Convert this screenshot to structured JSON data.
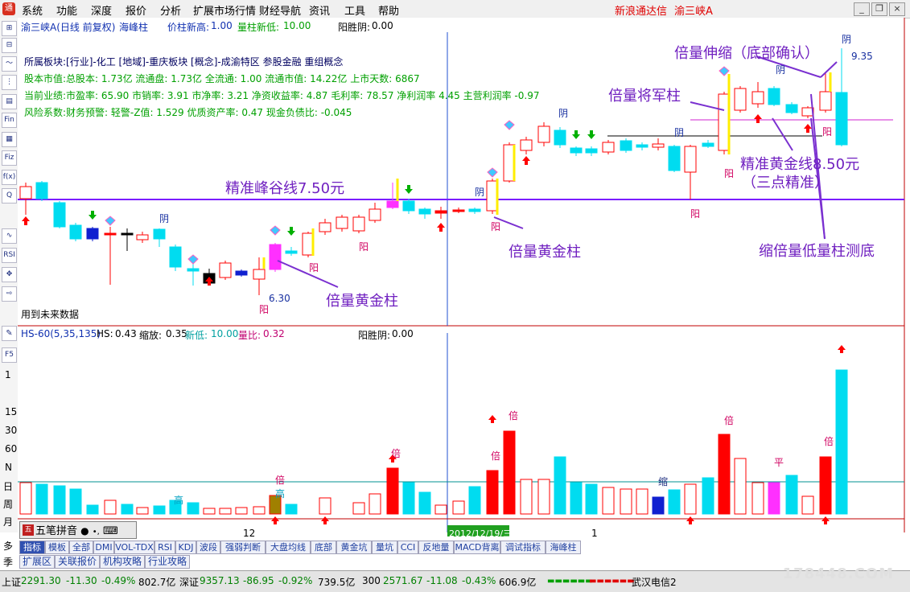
{
  "menubar": {
    "items": [
      "系统",
      "功能",
      "深度",
      "报价",
      "分析",
      "扩展市场行情",
      "财经导航",
      "资讯",
      "工具",
      "帮助"
    ],
    "app_name": "新浪通达信",
    "stock_name": "渝三峡A"
  },
  "price_panel": {
    "stock_label": "渝三峡A(日线 前复权)",
    "indicator_name": "海峰柱",
    "price_new_high_label": "价柱新高:",
    "price_new_high_value": "1.00",
    "vol_new_low_label": "量柱新低:",
    "vol_new_low_value": "10.00",
    "ysy_label": "阳胜阴:",
    "ysy_value": "0.00",
    "info_lines": [
      "所属板块:[行业]-化工 [地域]-重庆板块 [概念]-成渝特区 参股金融 重组概念",
      "股本市值:总股本: 1.73亿 流通盘: 1.73亿 全流通: 1.00 流通市值: 14.22亿 上市天数: 6867",
      "当前业绩:市盈率: 65.90 市销率: 3.91 市净率: 3.21 净资收益率: 4.87 毛利率: 78.57 净利润率 4.45 主营利润率 -0.97",
      "风险系数:财务预警: 轻警-Z值: 1.529 优质资产率: 0.47 现金负债比: -0.045"
    ],
    "future_data_label": "用到未来数据",
    "low_price_label": "6.30",
    "high_price_label": "9.35",
    "annotations": {
      "peak_valley_line": "精准峰谷线7.50元",
      "golden_line": "精准黄金线8.50元",
      "three_points": "（三点精准）",
      "stretch": "倍量伸缩（底部确认）",
      "general_pillar": "倍量将军柱",
      "golden_pillar_1": "倍量黄金柱",
      "golden_pillar_2": "倍量黄金柱",
      "shrink_test": "缩倍量低量柱测底"
    },
    "candle_labels": {
      "yin": "阴",
      "yang": "阳"
    }
  },
  "volume_panel": {
    "indicator_label": "HS-60(5,35,135)",
    "hs_label": "HS:",
    "hs_value": "0.43",
    "shrink_label": "缩放:",
    "shrink_value": "0.35",
    "new_low_label": "新低:",
    "new_low_value": "10.00",
    "vol_ratio_label": "量比:",
    "vol_ratio_value": "0.32",
    "ysy_label": "阳胜阴:",
    "ysy_value": "0.00",
    "bar_labels": {
      "bei": "倍",
      "gao": "高",
      "suo": "缩",
      "ping": "平"
    },
    "y_axis": [
      "1",
      "15",
      "30",
      "60",
      "N"
    ],
    "date_month_12": "12",
    "date_selected": "2012/12/19/三",
    "date_month_1": "1"
  },
  "left_toolbar": {
    "icons": [
      "⊞",
      "⊟",
      "～",
      "⋮",
      "▤",
      "Fin",
      "▦",
      "Fiz",
      "f(x)",
      "Q",
      "∿",
      "RSI",
      "✥",
      "⇨"
    ],
    "f5": "F5",
    "period_labels": [
      "日",
      "周",
      "月",
      "多",
      "季"
    ]
  },
  "ime": {
    "label": "五笔拼音",
    "grid_icon": "⌨"
  },
  "tabs": [
    "指标",
    "模板",
    "全部",
    "DMI",
    "VOL-TDX",
    "RSI",
    "KDJ",
    "波段",
    "强弱判断",
    "大盘均线",
    "底部",
    "黄金坑",
    "量坑",
    "CCI",
    "反地量",
    "MACD背离",
    "调试指标",
    "海峰柱"
  ],
  "tabs_row2": [
    "扩展区",
    "关联报价",
    "机构攻略",
    "行业攻略"
  ],
  "status_bar": {
    "sh_label": "上证",
    "sh_value": "2291.30",
    "sh_change": "-11.30",
    "sh_pct": "-0.49%",
    "sh_amount": "802.7亿",
    "sz_label": "深证",
    "sz_value": "9357.13",
    "sz_change": "-86.95",
    "sz_pct": "-0.92%",
    "sz_amount": "739.5亿",
    "i300_label": "300",
    "i300_value": "2571.67",
    "i300_change": "-11.08",
    "i300_pct": "-0.43%",
    "i300_amount": "606.9亿",
    "server": "武汉电信2"
  },
  "watermark": "178448.COM",
  "colors": {
    "up": "#ff0000",
    "down": "#00dcf0",
    "line": "#8020ff",
    "annot": "#7020c0"
  }
}
